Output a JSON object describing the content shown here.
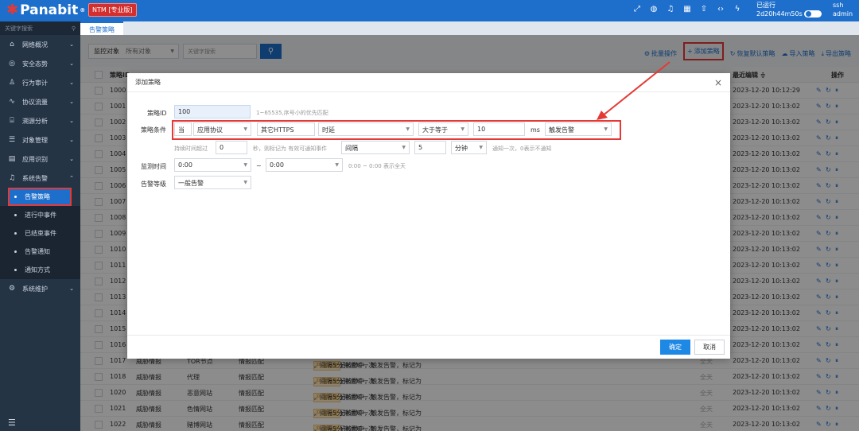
{
  "topbar": {
    "logo": "Panabit",
    "logo_sup": "®",
    "edition": "NTM [专业版]",
    "uptime_label": "已运行",
    "uptime_value": "2d20h44m50s",
    "user_proto": "ssh",
    "user_name": "admin"
  },
  "sidebar": {
    "search_placeholder": "关键字搜索",
    "items": [
      {
        "label": "网络概况",
        "icon": "home-icon"
      },
      {
        "label": "安全态势",
        "icon": "globe-icon"
      },
      {
        "label": "行为审计",
        "icon": "user-icon"
      },
      {
        "label": "协议流量",
        "icon": "pulse-icon"
      },
      {
        "label": "溯源分析",
        "icon": "bank-icon"
      },
      {
        "label": "对象管理",
        "icon": "list-icon"
      },
      {
        "label": "应用识别",
        "icon": "grid-icon"
      },
      {
        "label": "系统告警",
        "icon": "bell-icon"
      }
    ],
    "sub_items": [
      "告警策略",
      "进行中事件",
      "已结束事件",
      "告警通知",
      "通知方式"
    ],
    "last_item": {
      "label": "系统维护",
      "icon": "gear-icon"
    }
  },
  "tabs": [
    "告警策略"
  ],
  "toolbar": {
    "filter_label": "监控对象",
    "filter_value": "所有对象",
    "keyword_placeholder": "关键字搜索",
    "actions": [
      "批量操作",
      "添加策略",
      "恢复默认策略",
      "导入策略",
      "导出策略"
    ]
  },
  "table": {
    "headers": {
      "id": "策略ID",
      "last_edit": "最近编辑 ≑",
      "ops": "操作"
    },
    "rows": [
      {
        "id": "1000",
        "time": "2023-12-20 10:12:29"
      },
      {
        "id": "1001",
        "time": "2023-12-20 10:13:02"
      },
      {
        "id": "1002",
        "time": "2023-12-20 10:13:02"
      },
      {
        "id": "1003",
        "time": "2023-12-20 10:13:02"
      },
      {
        "id": "1004",
        "time": "2023-12-20 10:13:02"
      },
      {
        "id": "1005",
        "time": "2023-12-20 10:13:02"
      },
      {
        "id": "1006",
        "time": "2023-12-20 10:13:02"
      },
      {
        "id": "1007",
        "time": "2023-12-20 10:13:02"
      },
      {
        "id": "1008",
        "time": "2023-12-20 10:13:02"
      },
      {
        "id": "1009",
        "time": "2023-12-20 10:13:02"
      },
      {
        "id": "1010",
        "time": "2023-12-20 10:13:02"
      },
      {
        "id": "1011",
        "time": "2023-12-20 10:13:02"
      },
      {
        "id": "1012",
        "time": "2023-12-20 10:13:02"
      },
      {
        "id": "1013",
        "time": "2023-12-20 10:13:02"
      },
      {
        "id": "1014",
        "time": "2023-12-20 10:13:02"
      },
      {
        "id": "1015",
        "time": "2023-12-20 10:13:02"
      },
      {
        "id": "1016",
        "time": "2023-12-20 10:13:02"
      },
      {
        "id": "1017",
        "cat": "威胁情报",
        "target": "TOR节点",
        "type": "情报匹配",
        "desc_a": "当情报匹配被命中，触发告警，标记为",
        "tag": "严重告警",
        "desc_b": "，间隔5分钟通知一次",
        "period": "全天",
        "time": "2023-12-20 10:13:02"
      },
      {
        "id": "1018",
        "cat": "威胁情报",
        "target": "代理",
        "type": "情报匹配",
        "desc_a": "当情报匹配被命中，触发告警，标记为",
        "tag": "严重告警",
        "desc_b": "，间隔5分钟通知一次",
        "period": "全天",
        "time": "2023-12-20 10:13:02"
      },
      {
        "id": "1020",
        "cat": "威胁情报",
        "target": "恶意网站",
        "type": "情报匹配",
        "desc_a": "当情报匹配被命中，触发告警，标记为",
        "tag": "严重告警",
        "desc_b": "，间隔5分钟通知一次",
        "period": "全天",
        "time": "2023-12-20 10:13:02"
      },
      {
        "id": "1021",
        "cat": "威胁情报",
        "target": "色情网站",
        "type": "情报匹配",
        "desc_a": "当情报匹配被命中，触发告警，标记为",
        "tag": "严重告警",
        "desc_b": "，间隔5分钟通知一次",
        "period": "全天",
        "time": "2023-12-20 10:13:02"
      },
      {
        "id": "1022",
        "cat": "威胁情报",
        "target": "赌博网站",
        "type": "情报匹配",
        "desc_a": "当情报匹配被命中，触发告警，标记为",
        "tag": "严重告警",
        "desc_b": "，间隔5分钟通知一次",
        "period": "全天",
        "time": "2023-12-20 10:13:02"
      }
    ]
  },
  "modal": {
    "title": "添加策略",
    "policy_id_label": "策略ID",
    "policy_id_value": "100",
    "policy_id_hint": "1~65535,序号小的优先匹配",
    "condition_label": "策略条件",
    "when": "当",
    "cond_type": "应用协议",
    "cond_app": "其它HTTPS",
    "cond_metric": "时延",
    "cond_op": "大于等于",
    "cond_value": "10",
    "cond_unit": "ms",
    "cond_action": "触发告警",
    "duration_prefix": "持续时间超过",
    "duration_value": "0",
    "duration_suffix": "秒，则标记为 有效可通知事件",
    "interval_mode": "间隔",
    "interval_value": "5",
    "interval_unit": "分钟",
    "interval_hint": "通知一次，0表示不通知",
    "monitor_label": "监测时间",
    "monitor_from": "0:00",
    "monitor_sep": "~",
    "monitor_to": "0:00",
    "monitor_hint": "0:00 ~ 0:00 表示全天",
    "level_label": "告警等级",
    "level_value": "一般告警",
    "ok": "确定",
    "cancel": "取消"
  },
  "colors": {
    "primary": "#1e6fcc",
    "sidebar": "#253445",
    "highlight": "#e53935"
  }
}
